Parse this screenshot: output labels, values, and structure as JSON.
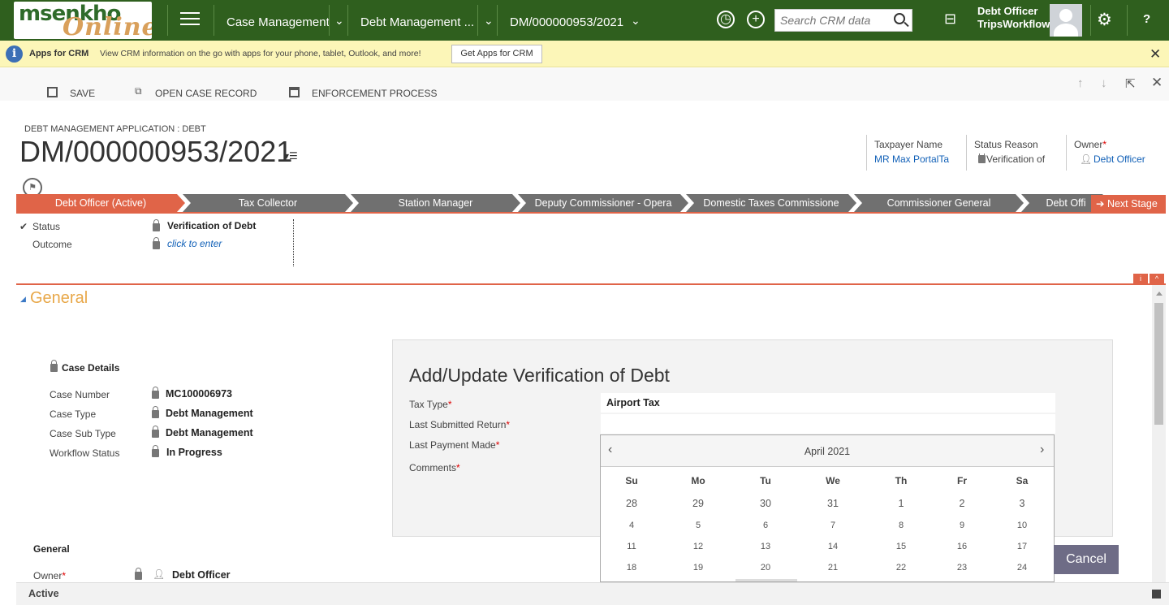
{
  "brand": {
    "logo_line1": "msenkho",
    "logo_line2": "Online"
  },
  "nav": {
    "items": [
      "Case Management",
      "Debt Management ...",
      "DM/000000953/2021"
    ],
    "search_placeholder": "Search CRM data",
    "user_name": "Debt Officer",
    "user_org": "TripsWorkflow",
    "help": "?"
  },
  "notification": {
    "title": "Apps for CRM",
    "text": "View CRM information on the go with apps for your phone, tablet, Outlook, and more!",
    "button": "Get Apps for CRM"
  },
  "commands": {
    "save": "SAVE",
    "open_case": "OPEN CASE RECORD",
    "enforcement": "ENFORCEMENT PROCESS"
  },
  "header": {
    "entity": "DEBT MANAGEMENT APPLICATION : DEBT",
    "title": "DM/000000953/2021",
    "taxpayer_label": "Taxpayer Name",
    "taxpayer_value": "MR Max PortalTa",
    "status_reason_label": "Status Reason",
    "status_reason_value": "Verification of",
    "owner_label": "Owner",
    "owner_value": "Debt Officer"
  },
  "bpf": {
    "stages": [
      "Debt Officer (Active)",
      "Tax Collector",
      "Station Manager",
      "Deputy Commissioner - Opera",
      "Domestic Taxes Commissione",
      "Commissioner General",
      "Debt Offi"
    ],
    "next_stage": "Next Stage",
    "status_label": "Status",
    "status_value": "Verification of Debt",
    "outcome_label": "Outcome",
    "outcome_value": "click to enter"
  },
  "section": {
    "title": "General",
    "corner_i": "i"
  },
  "case_details": {
    "heading": "Case Details",
    "fields": [
      {
        "label": "Case Number",
        "value": "MC100006973"
      },
      {
        "label": "Case Type",
        "value": "Debt Management"
      },
      {
        "label": "Case Sub Type",
        "value": "Debt Management"
      },
      {
        "label": "Workflow Status",
        "value": "In Progress"
      }
    ]
  },
  "general": {
    "heading": "General",
    "owner_label": "Owner",
    "owner_value": "Debt Officer"
  },
  "dialog": {
    "title": "Add/Update Verification of Debt",
    "tax_type_label": "Tax Type",
    "tax_type_value": "Airport Tax",
    "last_submitted_label": "Last Submitted Return",
    "last_payment_label": "Last Payment Made",
    "comments_label": "Comments",
    "cancel": "Cancel"
  },
  "calendar": {
    "month": "April 2021",
    "dow": [
      "Su",
      "Mo",
      "Tu",
      "We",
      "Th",
      "Fr",
      "Sa"
    ],
    "weeks": [
      [
        "28",
        "29",
        "30",
        "31",
        "1",
        "2",
        "3"
      ],
      [
        "4",
        "5",
        "6",
        "7",
        "8",
        "9",
        "10"
      ],
      [
        "11",
        "12",
        "13",
        "14",
        "15",
        "16",
        "17"
      ],
      [
        "18",
        "19",
        "20",
        "21",
        "22",
        "23",
        "24"
      ]
    ]
  },
  "footer": {
    "status": "Active"
  },
  "colors": {
    "nav_bg": "#2f5f1e",
    "stage_active": "#e06448",
    "stage_inactive": "#707070",
    "link": "#1160b7",
    "section_title": "#e8a84a"
  }
}
